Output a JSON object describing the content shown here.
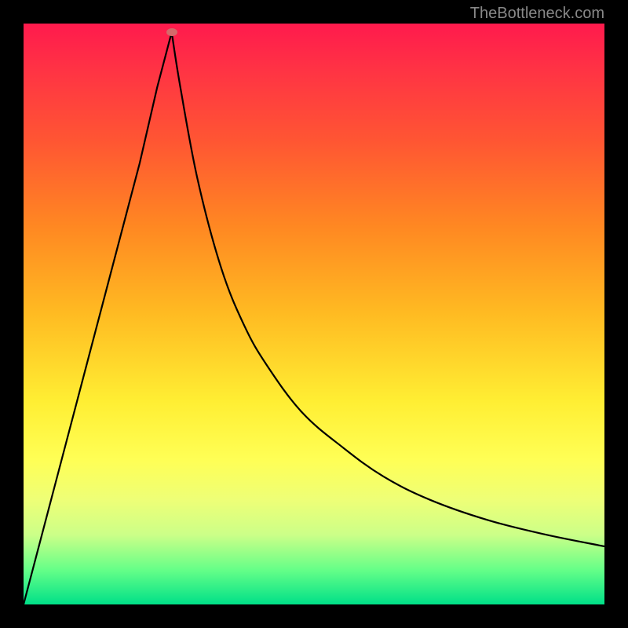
{
  "watermark": "TheBottleneck.com",
  "chart_data": {
    "type": "line",
    "title": "",
    "xlabel": "",
    "ylabel": "",
    "xlim": [
      0,
      100
    ],
    "ylim": [
      0,
      100
    ],
    "grid": false,
    "legend": false,
    "marker": {
      "x_pct": 25.5,
      "y_pct": 98.5
    },
    "series": [
      {
        "name": "left-branch",
        "x_pct": [
          0,
          5,
          10,
          15,
          20,
          23,
          25.5
        ],
        "y_pct": [
          0,
          19,
          38,
          57,
          76,
          89,
          98.5
        ]
      },
      {
        "name": "right-branch",
        "x_pct": [
          25.5,
          27,
          30,
          34,
          38,
          42,
          48,
          55,
          62,
          70,
          80,
          90,
          100
        ],
        "y_pct": [
          98.5,
          89,
          73,
          58,
          48,
          41,
          33,
          27,
          22,
          18,
          14.5,
          12,
          10
        ]
      }
    ],
    "colors": {
      "curve": "#000000",
      "marker": "#d46a6a",
      "background_gradient_top": "#ff1a4d",
      "background_gradient_bottom": "#00e088"
    }
  }
}
